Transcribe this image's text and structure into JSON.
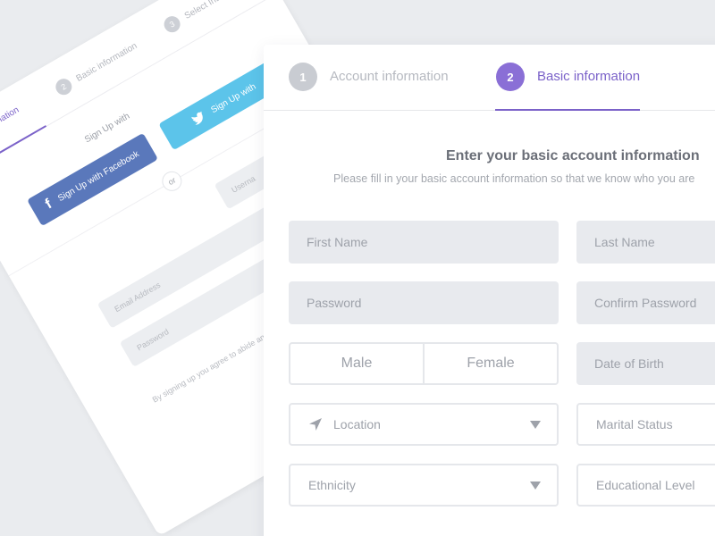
{
  "background_card": {
    "steps": [
      {
        "number": "",
        "label": "Account information"
      },
      {
        "number": "2",
        "label": "Basic information"
      },
      {
        "number": "3",
        "label": "Select Interests"
      }
    ],
    "signup_label": "Sign Up with",
    "facebook_button": "Sign Up with Facebook",
    "twitter_button": "Sign Up with",
    "or_label": "or",
    "username_placeholder": "Userna",
    "email_placeholder": "Email Address",
    "password_placeholder": "Password",
    "terms": "By signing up you agree to abide and"
  },
  "main_card": {
    "tabs": [
      {
        "number": "1",
        "label": "Account information",
        "state": "inactive"
      },
      {
        "number": "2",
        "label": "Basic information",
        "state": "active"
      }
    ],
    "heading": "Enter your basic account information",
    "subheading": "Please fill in your basic account information so that we know who you are",
    "fields": {
      "first_name": "First Name",
      "last_name": "Last Name",
      "password": "Password",
      "confirm_password": "Confirm Password",
      "gender_options": [
        "Male",
        "Female"
      ],
      "date_of_birth": "Date of Birth",
      "location": "Location",
      "marital_status": "Marital Status",
      "ethnicity": "Ethnicity",
      "educational_level": "Educational Level"
    }
  },
  "colors": {
    "accent": "#7b62c9",
    "facebook": "#5a78bb",
    "twitter": "#5cc4ea",
    "field_bg": "#e8eaee",
    "page_bg": "#eaecef"
  }
}
